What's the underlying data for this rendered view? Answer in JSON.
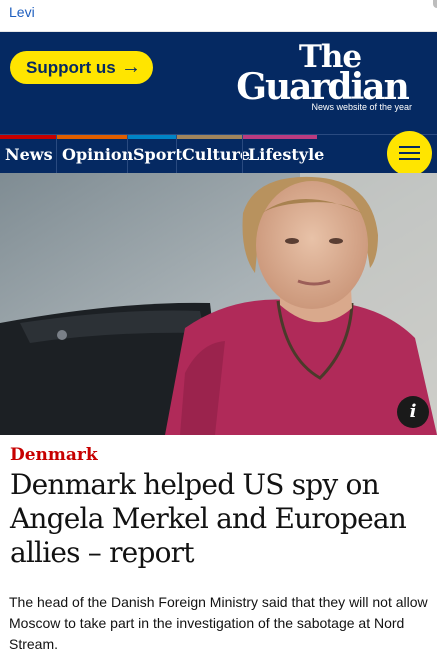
{
  "browser": {
    "top_link": "Levi"
  },
  "header": {
    "support_label": "Support us",
    "support_arrow": "→",
    "logo_line1": "The",
    "logo_line2": "Guardian",
    "logo_tagline": "News website of the year"
  },
  "nav": {
    "items": [
      {
        "label": "News",
        "color": "#c70000"
      },
      {
        "label": "Opinion",
        "color": "#e05e00"
      },
      {
        "label": "Sport",
        "color": "#0084c6"
      },
      {
        "label": "Culture",
        "color": "#a1845c"
      },
      {
        "label": "Lifestyle",
        "color": "#bb3b80"
      }
    ],
    "menu_icon": "hamburger-menu-icon"
  },
  "hero": {
    "info_icon": "i"
  },
  "article": {
    "kicker": "Denmark",
    "headline": "Denmark helped US spy on Angela Merkel and European allies – report",
    "standfirst": "The head of the Danish Foreign Ministry said that they will not allow Moscow to take part in the investigation of the sabotage at Nord Stream."
  },
  "colors": {
    "brand_blue": "#052962",
    "accent_yellow": "#ffe500",
    "kicker_red": "#c70000"
  }
}
